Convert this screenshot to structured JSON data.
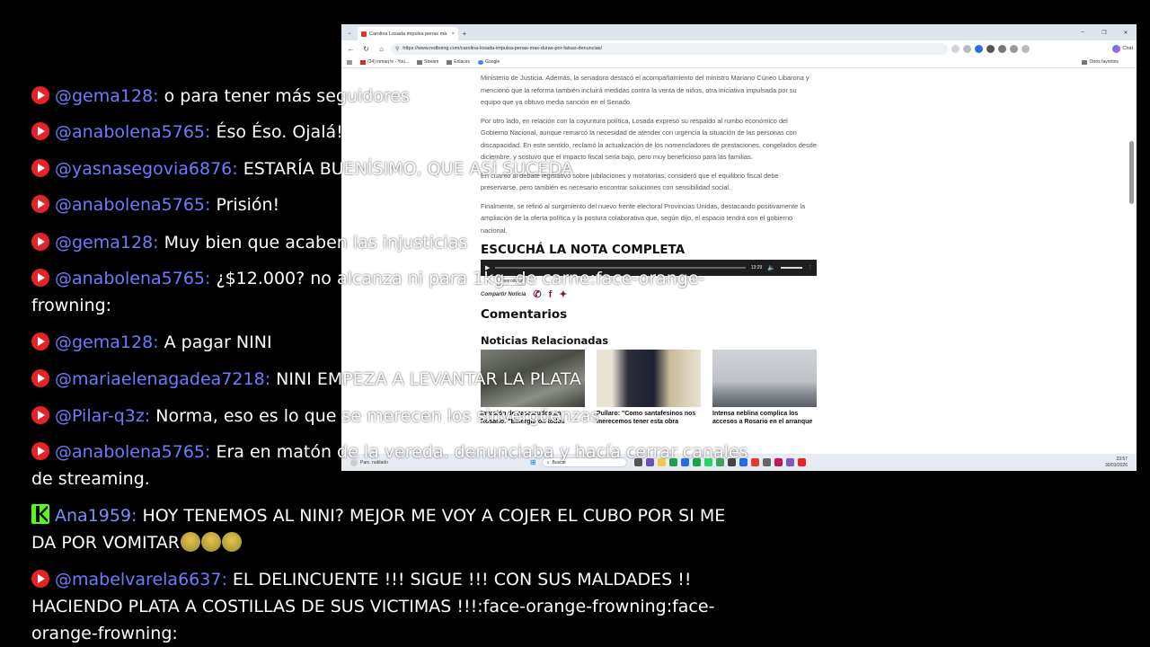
{
  "browser": {
    "tab_title": "Carolina Losada impulsa penas má",
    "tab_close": "×",
    "new_tab": "+",
    "window_controls": [
      "–",
      "❐",
      "✕"
    ],
    "url": "https://www.redboing.com/carolina-losada-impulsa-penas-mas-duras-por-falsas-denuncias/",
    "chat_label": "Chat",
    "bookmarks": [
      "(34) inmaq tv - You...",
      "Stream",
      "Enlaces",
      "Google"
    ],
    "other_bookmarks": "Otros favoritos"
  },
  "article": {
    "paragraphs": [
      "Ministerio de Justicia. Además, la senadora destacó el acompañamiento del ministro Mariano Cúneo Libarona y mencionó que la reforma también incluirá medidas contra la venta de niños, otra iniciativa impulsada por su equipo que ya obtuvo media sanción en el Senado.",
      "Por otro lado, en relación con la coyuntura política, Losada expresó su respaldo al rumbo económico del Gobierno Nacional, aunque remarcó la necesidad de atender con urgencia la situación de las personas con discapacidad. En este sentido, reclamó la actualización de los nomencladores de prestaciones, congelados desde diciembre, y sostuvo que el impacto fiscal sería bajo, pero muy beneficioso para las familias.",
      "En cuanto al debate legislativo sobre jubilaciones y moratorias, consideró que el equilibrio fiscal debe preservarse, pero también es necesario encontrar soluciones con sensibilidad social.",
      "Finalmente, se refirió al surgimiento del nuevo frente electoral Provincias Unidas, destacando positivamente la ampliación de la oferta política y la postura colaborativa que, según dijo, el espacio tendrá con el gobierno nacional."
    ],
    "listen_heading": "ESCUCHÁ LA NOTA COMPLETA",
    "audio_time": "13:29",
    "play_tooltip": "Reproducir",
    "share_label": "Compartir Noticia",
    "comments_heading": "Comentarios",
    "related_heading": "Noticias Relacionadas",
    "related": [
      {
        "title": "Invasión de cascarudos en Rosario: \"Emergieron todos juntos por las lluvias y el"
      },
      {
        "title": "Pullaro: \"Como santafesinos nos merecemos tener esta obra terminada y no es una"
      },
      {
        "title": "Intensa neblina complica los accesos a Rosario en el arranque de la semana"
      }
    ]
  },
  "taskbar": {
    "weather": "Parc. nublado",
    "search_placeholder": "Buscar",
    "time": "23:57",
    "date": "30/03/2026"
  },
  "chat": {
    "messages": [
      {
        "platform": "youtube",
        "user": "@gema128",
        "text": "o para tener más seguidores"
      },
      {
        "platform": "youtube",
        "user": "@anabolena5765",
        "text": "Éso Éso. Ojalá!"
      },
      {
        "platform": "youtube",
        "user": "@yasnasegovia6876",
        "text": "ESTARÍA BUENÍSIMO, QUE ASÍ SUCEDA"
      },
      {
        "platform": "youtube",
        "user": "@anabolena5765",
        "text": "Prisión!"
      },
      {
        "platform": "youtube",
        "user": "@gema128",
        "text": "Muy bien que acaben las injusticias"
      },
      {
        "platform": "youtube",
        "user": "@anabolena5765",
        "text": "¿$12.000? no alcanza ni para 1kg. de carne:face-orange-frowning:"
      },
      {
        "platform": "youtube",
        "user": "@gema128",
        "text": "A pagar NINI"
      },
      {
        "platform": "youtube",
        "user": "@mariaelenagadea7218",
        "text": "NINI EMPEZA A LEVANTAR LA PLATA"
      },
      {
        "platform": "youtube",
        "user": "@Pilar-q3z",
        "text": "Norma, eso es lo que se merecen los sinvergüenzas"
      },
      {
        "platform": "youtube",
        "user": "@anabolena5765",
        "text": "Era en matón de la vereda. denunciaba y hacía cerrar canales de streaming."
      },
      {
        "platform": "kick",
        "user": "Ana1959",
        "text": "HOY TENEMOS AL NINI? MEJOR ME VOY A COJER EL CUBO POR SI ME DA POR VOMITAR"
      },
      {
        "platform": "youtube",
        "user": "@mabelvarela6637",
        "text": "EL DELINCUENTE !!! SIGUE !!! CON SUS MALDADES !! HACIENDO PLATA A COSTILLAS DE SUS VICTIMAS !!!:face-orange-frowning:face-orange-frowning:"
      }
    ],
    "separator": ": "
  },
  "colors": {
    "username": "#6f7bff",
    "youtube": "#e5242a",
    "kick": "#53fc18"
  }
}
